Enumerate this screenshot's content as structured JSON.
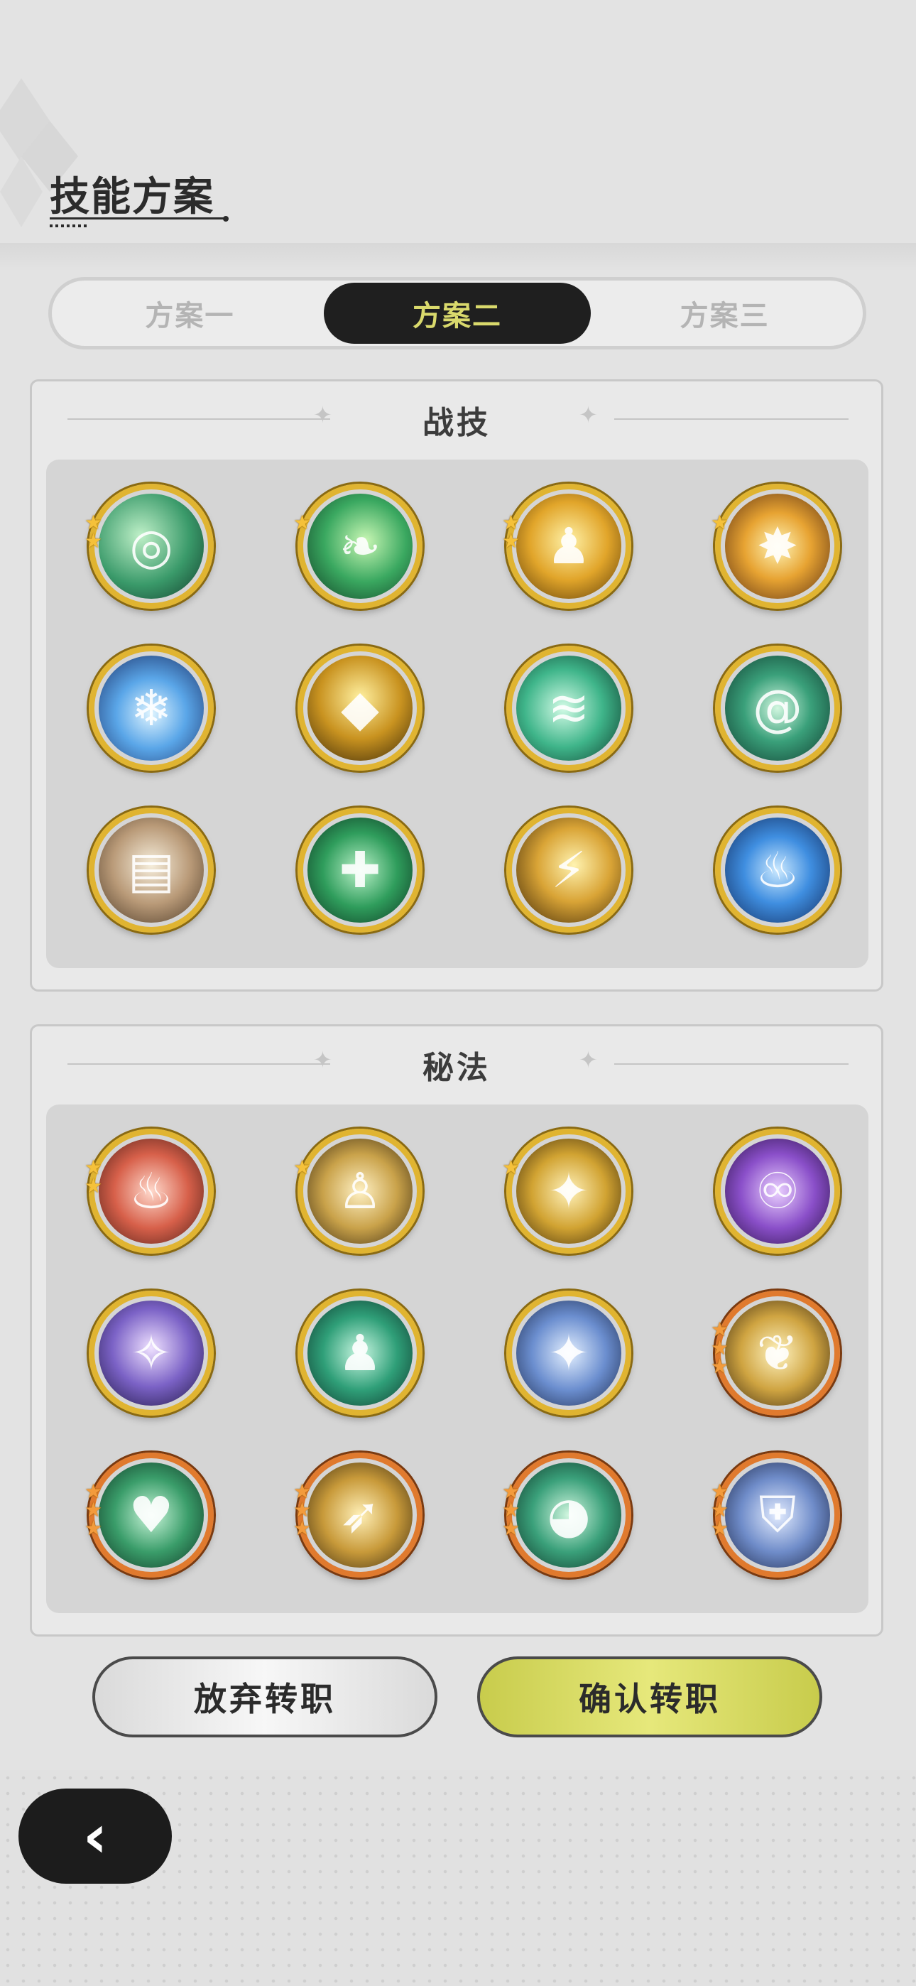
{
  "header": {
    "title": "技能方案"
  },
  "tabs": [
    {
      "label": "方案一",
      "active": false
    },
    {
      "label": "方案二",
      "active": true
    },
    {
      "label": "方案三",
      "active": false
    }
  ],
  "combat_skills": {
    "title": "战技",
    "icons": [
      {
        "name": "green-swirl-orb-icon",
        "bg": "radial-gradient(circle at 40% 40%,#bff0c8,#3a9a6a 55%,#113a2a)",
        "glyph": "◎",
        "stars": 2,
        "frame": "gold"
      },
      {
        "name": "green-flame-dash-icon",
        "bg": "radial-gradient(circle at 55% 45%,#c9f7b4,#3aa860 50%,#0e3a22)",
        "glyph": "❧",
        "stars": 1,
        "frame": "gold"
      },
      {
        "name": "golden-guardian-icon",
        "bg": "radial-gradient(circle at 50% 45%,#fff2a8,#e1a52a 50%,#5a3a08)",
        "glyph": "♟",
        "stars": 2,
        "frame": "gold"
      },
      {
        "name": "golden-burst-icon",
        "bg": "radial-gradient(circle at 50% 50%,#fff6b8,#e7a332 45%,#5a2f12)",
        "glyph": "✸",
        "stars": 1,
        "frame": "gold"
      },
      {
        "name": "ice-shatter-icon",
        "bg": "radial-gradient(circle at 50% 55%,#dff4ff,#5aa6e8 45%,#1a2e66)",
        "glyph": "❄",
        "stars": 0,
        "frame": "gold"
      },
      {
        "name": "golden-crystal-icon",
        "bg": "radial-gradient(circle at 50% 40%,#fff0a0,#c99320 50%,#3a2808)",
        "glyph": "◆",
        "stars": 0,
        "frame": "gold"
      },
      {
        "name": "wind-slash-icon",
        "bg": "radial-gradient(circle at 45% 50%,#d2fbe6,#3fb58a 50%,#0e3b2c)",
        "glyph": "≋",
        "stars": 0,
        "frame": "gold"
      },
      {
        "name": "green-vortex-icon",
        "bg": "radial-gradient(circle at 50% 50%,#d2f7e0,#3aa07a 45%,#0f3a2e)",
        "glyph": "@",
        "stars": 0,
        "frame": "gold"
      },
      {
        "name": "stone-cards-icon",
        "bg": "radial-gradient(circle at 50% 45%,#f6eedc,#b99a78 50%,#4a3826)",
        "glyph": "▤",
        "stars": 0,
        "frame": "gold"
      },
      {
        "name": "green-heal-icon",
        "bg": "radial-gradient(circle at 50% 50%,#baf1c8,#2f9d5c 50%,#0c3320)",
        "glyph": "✚",
        "stars": 0,
        "frame": "gold"
      },
      {
        "name": "lightning-comet-icon",
        "bg": "radial-gradient(circle at 55% 45%,#fff3b0,#d9a436 45%,#3a2406)",
        "glyph": "⚡",
        "stars": 0,
        "frame": "gold"
      },
      {
        "name": "blue-flame-icon",
        "bg": "radial-gradient(circle at 50% 50%,#cbe9ff,#3f8ee0 45%,#112a5c)",
        "glyph": "♨",
        "stars": 0,
        "frame": "gold"
      }
    ]
  },
  "secret_arts": {
    "title": "秘法",
    "icons": [
      {
        "name": "red-flame-rune-icon",
        "bg": "radial-gradient(circle at 50% 50%,#ffd9cc,#d7604a 50%,#4a1d16)",
        "glyph": "♨",
        "stars": 2,
        "frame": "gold"
      },
      {
        "name": "golden-figure-rune-icon",
        "bg": "radial-gradient(circle at 50% 50%,#fff1c4,#c9a24a 50%,#3a2a10)",
        "glyph": "♙",
        "stars": 1,
        "frame": "gold"
      },
      {
        "name": "golden-shatter-rune-icon",
        "bg": "radial-gradient(circle at 50% 50%,#fff2bb,#d1a332 50%,#3d2a0a)",
        "glyph": "✦",
        "stars": 1,
        "frame": "gold"
      },
      {
        "name": "purple-swirl-rune-icon",
        "bg": "radial-gradient(circle at 50% 50%,#ead0ff,#8a4fc9 50%,#2a1244)",
        "glyph": "♾",
        "stars": 0,
        "frame": "gold"
      },
      {
        "name": "sparkle-stage-rune-icon",
        "bg": "radial-gradient(circle at 50% 45%,#efe1ff,#7b62c6 50%,#1e1640)",
        "glyph": "✧",
        "stars": 0,
        "frame": "gold"
      },
      {
        "name": "green-meditate-rune-icon",
        "bg": "radial-gradient(circle at 50% 50%,#c9f7e2,#2f9f78 50%,#0d332a)",
        "glyph": "♟",
        "stars": 0,
        "frame": "gold"
      },
      {
        "name": "blue-star-rune-icon",
        "bg": "radial-gradient(circle at 50% 50%,#e4f0ff,#6b8ecf 50%,#1c2a4c)",
        "glyph": "✦",
        "stars": 0,
        "frame": "gold"
      },
      {
        "name": "golden-feather-rune-icon",
        "bg": "radial-gradient(circle at 50% 50%,#fff4c2,#cfa441 50%,#3a2810)",
        "glyph": "❦",
        "stars": 3,
        "frame": "orange"
      },
      {
        "name": "green-heart-rune-icon",
        "bg": "radial-gradient(circle at 50% 50%,#c9f5d9,#3a9d6a 50%,#0e3322)",
        "glyph": "♥",
        "stars": 3,
        "frame": "orange"
      },
      {
        "name": "golden-wing-rune-icon",
        "bg": "radial-gradient(circle at 50% 50%,#fff0b8,#c89a3a 50%,#3a2a10)",
        "glyph": "➶",
        "stars": 3,
        "frame": "orange"
      },
      {
        "name": "green-helm-rune-icon",
        "bg": "radial-gradient(circle at 50% 50%,#d2f7e0,#3aa07a 50%,#0e3326)",
        "glyph": "◕",
        "stars": 3,
        "frame": "orange"
      },
      {
        "name": "blue-armor-rune-icon",
        "bg": "radial-gradient(circle at 50% 50%,#e3ecff,#6f8cc9 50%,#1c2646)",
        "glyph": "⛨",
        "stars": 3,
        "frame": "orange"
      }
    ]
  },
  "actions": {
    "abandon_label": "放弃转职",
    "confirm_label": "确认转职"
  }
}
